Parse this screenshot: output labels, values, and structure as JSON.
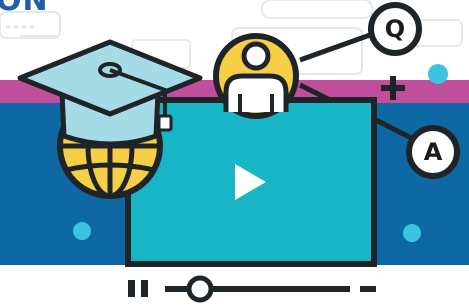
{
  "heading_fragment": "ON",
  "bubbles": {
    "question": "Q",
    "answer": "A"
  },
  "colors": {
    "band_top": "#c04f9b",
    "band_main": "#0e68a3",
    "screen": "#17b5c5",
    "outline": "#1e2427",
    "cap": "#a5dbe6",
    "globe": "#f6cf46",
    "accent_dot": "#3bc4e0",
    "heading": "#1f5ea8"
  },
  "icons": [
    "graduation-cap-icon",
    "globe-icon",
    "user-avatar-icon",
    "play-icon",
    "pause-icon",
    "plus-icon",
    "minus-icon",
    "question-bubble-icon",
    "answer-bubble-icon"
  ]
}
